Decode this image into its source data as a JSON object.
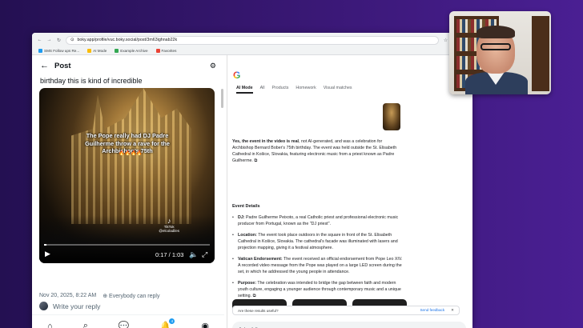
{
  "browser": {
    "url": "boky.app/profile/vuc.boky.social/post/3m63ighnab22k",
    "bookmarks": [
      "SMS Follow ups Re...",
      "AI Mode",
      "Example Archive",
      "Favorites"
    ]
  },
  "post": {
    "header_title": "Post",
    "text": "birthday this is kind of incredible",
    "video": {
      "caption": "The Pope really had DJ Padre Guilherme throw a rave for the Archbishop’s 75th",
      "fires": "🔥🔥🔥🔥",
      "watermark": "TikTok",
      "watermark_user": "@elcoladiles",
      "time": "0:17 / 1:03",
      "progress": 0.015
    },
    "date": "Nov 20, 2025, 8:22 AM",
    "reply_permission": "Everybody can reply",
    "reply_placeholder": "Write your reply",
    "nav_badge": "4"
  },
  "ai": {
    "logo": "G",
    "tabs": [
      "AI Mode",
      "All",
      "Products",
      "Homework",
      "Visual matches"
    ],
    "answer_bold": "Yes, the event in the video is real",
    "answer_rest": ", not AI-generated, and was a celebration for Archbishop Bernard Bober's 75th birthday. The event was held outside the St. Elisabeth Cathedral in Košice, Slovakia, featuring electronic music from a priest known as Padre Guilherme.",
    "section_title": "Event Details",
    "bullets": [
      {
        "label": "DJ:",
        "text": " Padre Guilherme Peixoto, a real Catholic priest and professional electronic music producer from Portugal, known as the \"DJ priest\"."
      },
      {
        "label": "Location:",
        "text": " The event took place outdoors in the square in front of the St. Elisabeth Cathedral in Košice, Slovakia. The cathedral's facade was illuminated with lasers and projection mapping, giving it a festival atmosphere."
      },
      {
        "label": "Vatican Endorsement:",
        "text": " The event received an official endorsement from Pope Leo XIV. A recorded video message from the Pope was played on a large LED screen during the set, in which he addressed the young people in attendance."
      },
      {
        "label": "Purpose:",
        "text": " The celebration was intended to bridge the gap between faith and modern youth culture, engaging a younger audience through contemporary music and a unique setting."
      }
    ],
    "feedback_question": "Are these results useful?",
    "feedback_send": "Send feedback",
    "followup_placeholder": "Ask a follow up"
  }
}
